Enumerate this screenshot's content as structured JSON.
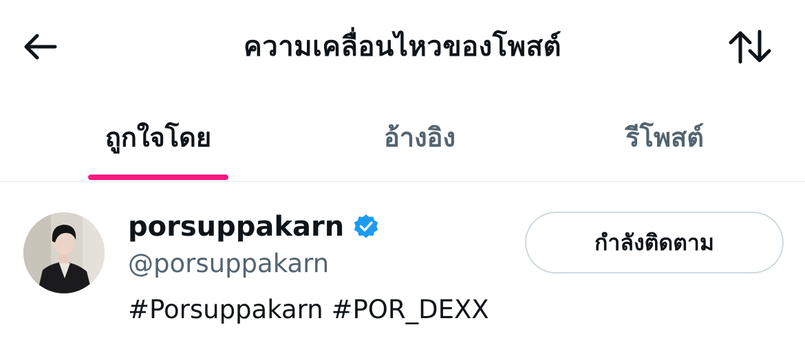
{
  "header": {
    "title": "ความเคลื่อนไหวของโพสต์",
    "back_icon": "arrow-left-icon",
    "sort_icon": "sort-arrows-icon"
  },
  "tabs": [
    {
      "label": "ถูกใจโดย",
      "active": true
    },
    {
      "label": "อ้างอิง",
      "active": false
    },
    {
      "label": "รีโพสต์",
      "active": false
    }
  ],
  "accent_color": "#f91880",
  "verified_color": "#1d9bf0",
  "users": [
    {
      "display_name": "porsuppakarn",
      "verified": true,
      "handle": "@porsuppakarn",
      "bio": "#Porsuppakarn #POR_DEXX",
      "follow_button_label": "กำลังติดตาม"
    }
  ]
}
